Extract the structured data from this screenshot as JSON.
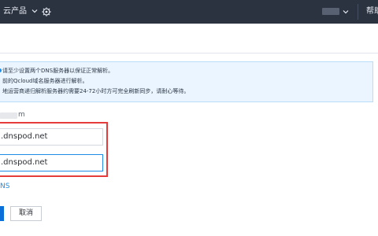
{
  "topbar": {
    "products_label": "云产品",
    "products_chevron_icon": "chevron-down-icon",
    "settings_icon": "gear-icon",
    "help_label": "帮助"
  },
  "notice": {
    "line1": "请至少设置两个DNS服务器以保证正常解析。",
    "line2": "前的Qcloud域名服务器进行解析。",
    "line3": "地运营商递归解析服务器约需要24-72小时方可完全刷新同步，请耐心等待。"
  },
  "form": {
    "domain_suffix": "m",
    "dns_field_1": ".dnspod.net",
    "dns_field_2": ".dnspod.net",
    "add_dns_link": "NS"
  },
  "actions": {
    "cancel_label": "取消"
  },
  "colors": {
    "topbar_bg": "#2b3240",
    "accent": "#1e8be6",
    "highlight_border": "#e53b3b",
    "notice_bg": "#eaf5ff"
  }
}
